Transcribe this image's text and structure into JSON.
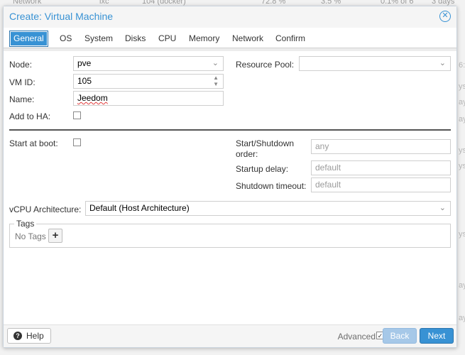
{
  "background": {
    "row": {
      "col_name": "Network",
      "col_type": "lxc",
      "col_id": "104 (docker)",
      "col_cpu": "72.8 %",
      "col_mem": "3.5 %",
      "col_disk": "0.1% of 6",
      "col_uptime": "3 days"
    },
    "right_fragments": [
      "6:4",
      "ys",
      "ays",
      "ays",
      "ys",
      "ys",
      "ys",
      "ays",
      "ays"
    ]
  },
  "dialog": {
    "title": "Create: Virtual Machine",
    "tabs": [
      "General",
      "OS",
      "System",
      "Disks",
      "CPU",
      "Memory",
      "Network",
      "Confirm"
    ],
    "active_tab": "General"
  },
  "form": {
    "node_label": "Node:",
    "node_value": "pve",
    "vmid_label": "VM ID:",
    "vmid_value": "105",
    "name_label": "Name:",
    "name_value": "Jeedom",
    "ha_label": "Add to HA:",
    "ha_checked": false,
    "pool_label": "Resource Pool:",
    "pool_value": "",
    "start_boot_label": "Start at boot:",
    "start_boot_checked": false,
    "order_label_line1": "Start/Shutdown",
    "order_label_line2": "order:",
    "order_placeholder": "any",
    "startup_label": "Startup delay:",
    "startup_placeholder": "default",
    "shutdown_label": "Shutdown timeout:",
    "shutdown_placeholder": "default",
    "vcpu_label": "vCPU Architecture:",
    "vcpu_value": "Default (Host Architecture)",
    "tags_legend": "Tags",
    "tags_empty": "No Tags"
  },
  "footer": {
    "help_label": "Help",
    "advanced_label": "Advanced",
    "advanced_checked": true,
    "back_label": "Back",
    "next_label": "Next"
  },
  "colors": {
    "accent": "#3892d4",
    "accent_disabled": "#a6c8e8",
    "separator": "#555555"
  }
}
